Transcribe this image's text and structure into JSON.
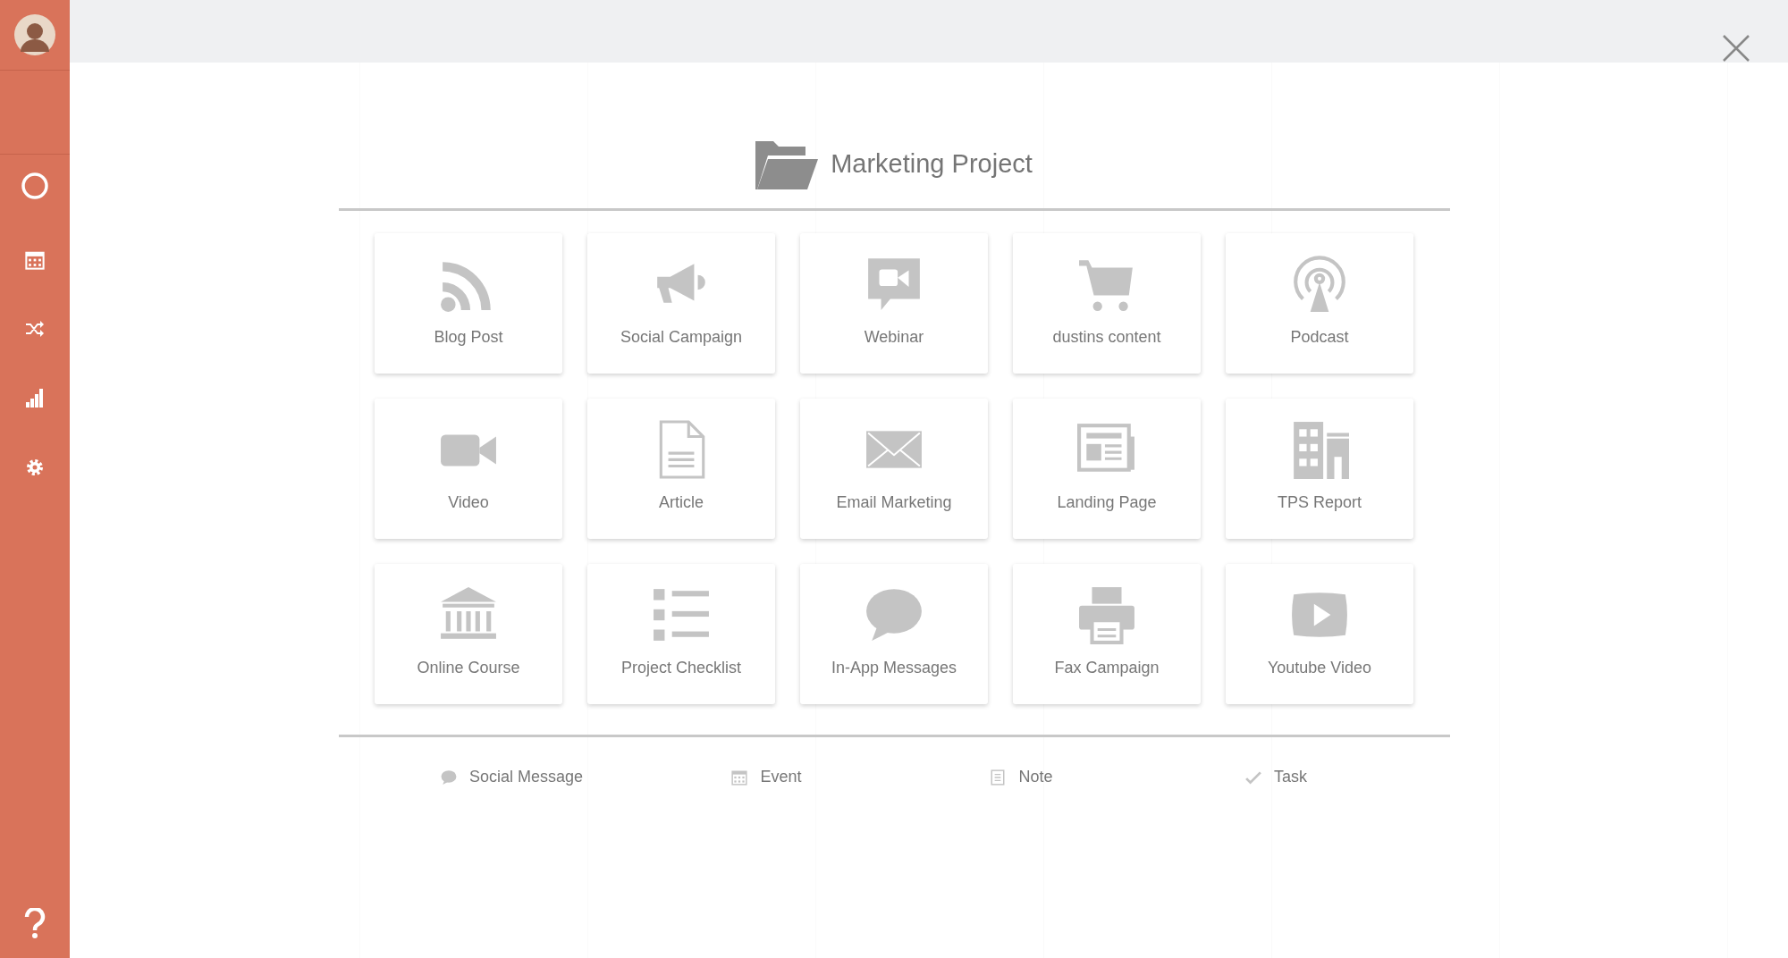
{
  "modal": {
    "title": "Marketing Project",
    "types": [
      {
        "label": "Blog Post",
        "kind": "rss"
      },
      {
        "label": "Social Campaign",
        "kind": "megaphone"
      },
      {
        "label": "Webinar",
        "kind": "webinar"
      },
      {
        "label": "dustins content",
        "kind": "cart"
      },
      {
        "label": "Podcast",
        "kind": "podcast"
      },
      {
        "label": "Video",
        "kind": "camera"
      },
      {
        "label": "Article",
        "kind": "document"
      },
      {
        "label": "Email Marketing",
        "kind": "envelope"
      },
      {
        "label": "Landing Page",
        "kind": "newspaper"
      },
      {
        "label": "TPS Report",
        "kind": "building"
      },
      {
        "label": "Online Course",
        "kind": "bank"
      },
      {
        "label": "Project Checklist",
        "kind": "list"
      },
      {
        "label": "In-App Messages",
        "kind": "bubble"
      },
      {
        "label": "Fax Campaign",
        "kind": "printer"
      },
      {
        "label": "Youtube Video",
        "kind": "play"
      }
    ],
    "quick": [
      {
        "label": "Social Message",
        "kind": "bubble"
      },
      {
        "label": "Event",
        "kind": "calendar"
      },
      {
        "label": "Note",
        "kind": "note"
      },
      {
        "label": "Task",
        "kind": "check"
      }
    ]
  }
}
